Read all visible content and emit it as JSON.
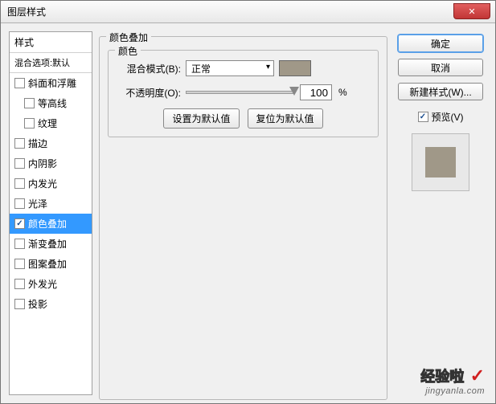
{
  "window": {
    "title": "图层样式"
  },
  "left": {
    "header": "样式",
    "sub": "混合选项:默认",
    "items": [
      {
        "label": "斜面和浮雕",
        "checked": false,
        "sub": false
      },
      {
        "label": "等高线",
        "checked": false,
        "sub": true
      },
      {
        "label": "纹理",
        "checked": false,
        "sub": true
      },
      {
        "label": "描边",
        "checked": false,
        "sub": false
      },
      {
        "label": "内阴影",
        "checked": false,
        "sub": false
      },
      {
        "label": "内发光",
        "checked": false,
        "sub": false
      },
      {
        "label": "光泽",
        "checked": false,
        "sub": false
      },
      {
        "label": "颜色叠加",
        "checked": true,
        "sub": false,
        "selected": true
      },
      {
        "label": "渐变叠加",
        "checked": false,
        "sub": false
      },
      {
        "label": "图案叠加",
        "checked": false,
        "sub": false
      },
      {
        "label": "外发光",
        "checked": false,
        "sub": false
      },
      {
        "label": "投影",
        "checked": false,
        "sub": false
      }
    ]
  },
  "center": {
    "section_title": "颜色叠加",
    "group_title": "颜色",
    "blend_label": "混合模式(B):",
    "blend_value": "正常",
    "color_hex": "#a09888",
    "opacity_label": "不透明度(O):",
    "opacity_value": "100",
    "opacity_unit": "%",
    "btn_default": "设置为默认值",
    "btn_reset": "复位为默认值"
  },
  "right": {
    "ok": "确定",
    "cancel": "取消",
    "new_style": "新建样式(W)...",
    "preview_label": "预览(V)",
    "preview_checked": true
  },
  "watermark": {
    "line1": "经验啦",
    "line2": "jingyanla.com"
  }
}
